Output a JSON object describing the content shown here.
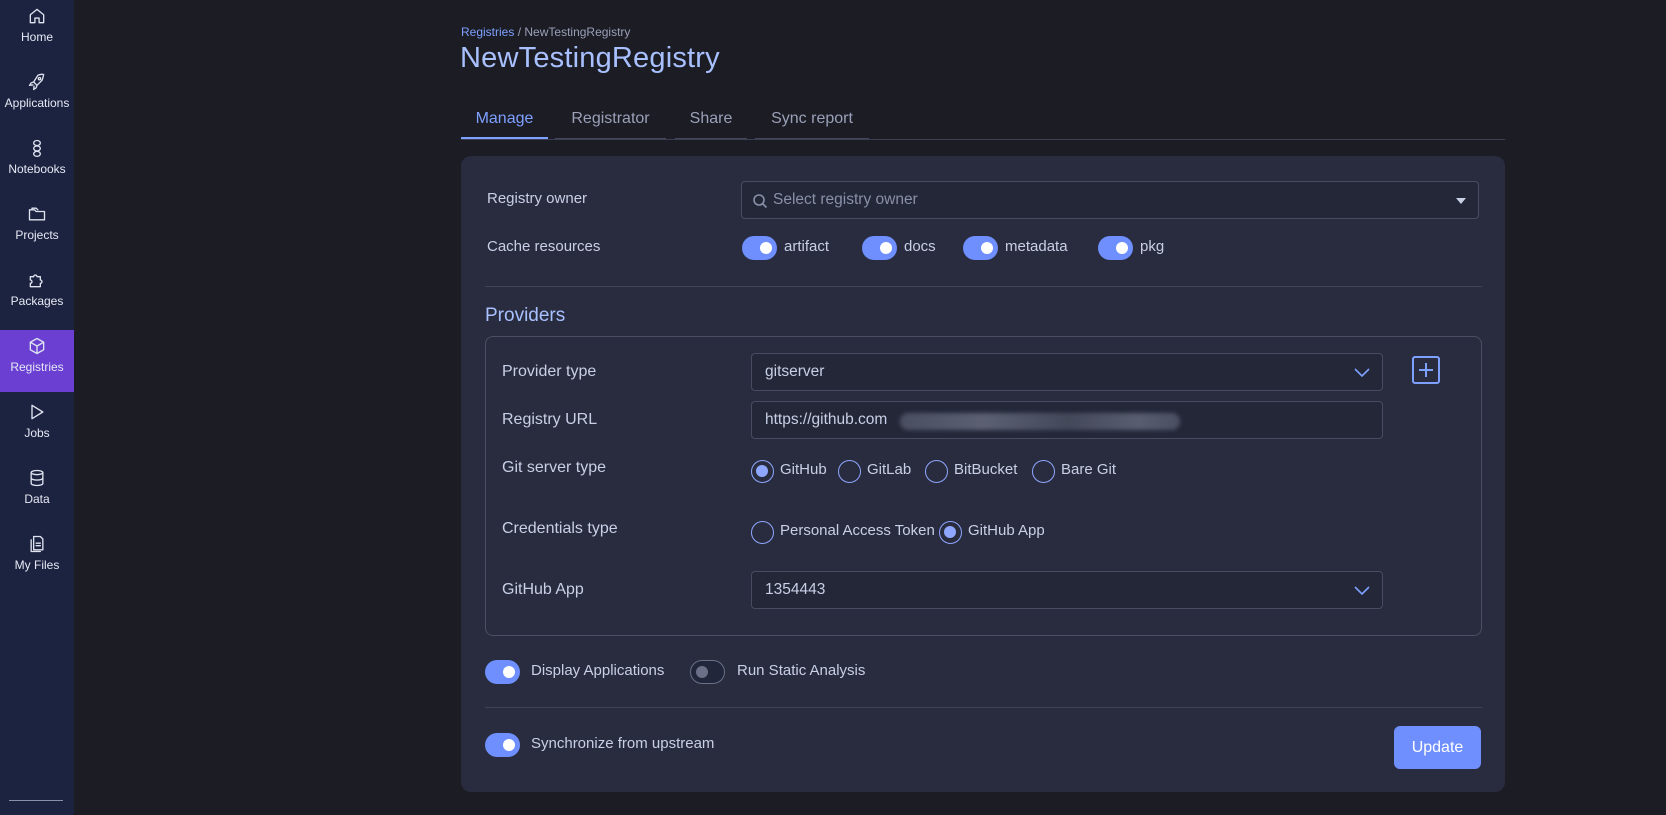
{
  "sidebar": {
    "items": [
      {
        "label": "Home",
        "icon": "home-icon"
      },
      {
        "label": "Applications",
        "icon": "rocket-icon"
      },
      {
        "label": "Notebooks",
        "icon": "notebook-icon"
      },
      {
        "label": "Projects",
        "icon": "folder-icon"
      },
      {
        "label": "Packages",
        "icon": "puzzle-icon"
      },
      {
        "label": "Registries",
        "icon": "box-icon",
        "active": true
      },
      {
        "label": "Jobs",
        "icon": "play-icon"
      },
      {
        "label": "Data",
        "icon": "database-icon"
      },
      {
        "label": "My Files",
        "icon": "files-icon"
      }
    ]
  },
  "breadcrumb": {
    "parent": "Registries",
    "separator": "/",
    "current": "NewTestingRegistry"
  },
  "page_title": "NewTestingRegistry",
  "tabs": [
    {
      "label": "Manage",
      "active": true
    },
    {
      "label": "Registrator"
    },
    {
      "label": "Share"
    },
    {
      "label": "Sync report"
    }
  ],
  "form": {
    "registry_owner": {
      "label": "Registry owner",
      "placeholder": "Select registry owner"
    },
    "cache_resources": {
      "label": "Cache resources",
      "options": [
        {
          "label": "artifact",
          "enabled": true
        },
        {
          "label": "docs",
          "enabled": true
        },
        {
          "label": "metadata",
          "enabled": true
        },
        {
          "label": "pkg",
          "enabled": true
        }
      ]
    },
    "providers": {
      "title": "Providers",
      "provider_type": {
        "label": "Provider type",
        "value": "gitserver"
      },
      "registry_url": {
        "label": "Registry URL",
        "value": "https://github.com"
      },
      "git_server_type": {
        "label": "Git server type",
        "options": [
          {
            "label": "GitHub",
            "checked": true
          },
          {
            "label": "GitLab",
            "checked": false
          },
          {
            "label": "BitBucket",
            "checked": false
          },
          {
            "label": "Bare Git",
            "checked": false
          }
        ]
      },
      "credentials_type": {
        "label": "Credentials type",
        "options": [
          {
            "label": "Personal Access Token",
            "checked": false
          },
          {
            "label": "GitHub App",
            "checked": true
          }
        ]
      },
      "github_app": {
        "label": "GitHub App",
        "value": "1354443"
      }
    },
    "display_applications": {
      "label": "Display Applications",
      "enabled": true
    },
    "run_static_analysis": {
      "label": "Run Static Analysis",
      "enabled": false
    },
    "synchronize_upstream": {
      "label": "Synchronize from upstream",
      "enabled": true
    },
    "update_label": "Update"
  },
  "colors": {
    "accent": "#6f8fff",
    "active_nav": "#6a3fd2",
    "sidebar_bg": "#1c2340",
    "card_bg": "#282c3e"
  }
}
